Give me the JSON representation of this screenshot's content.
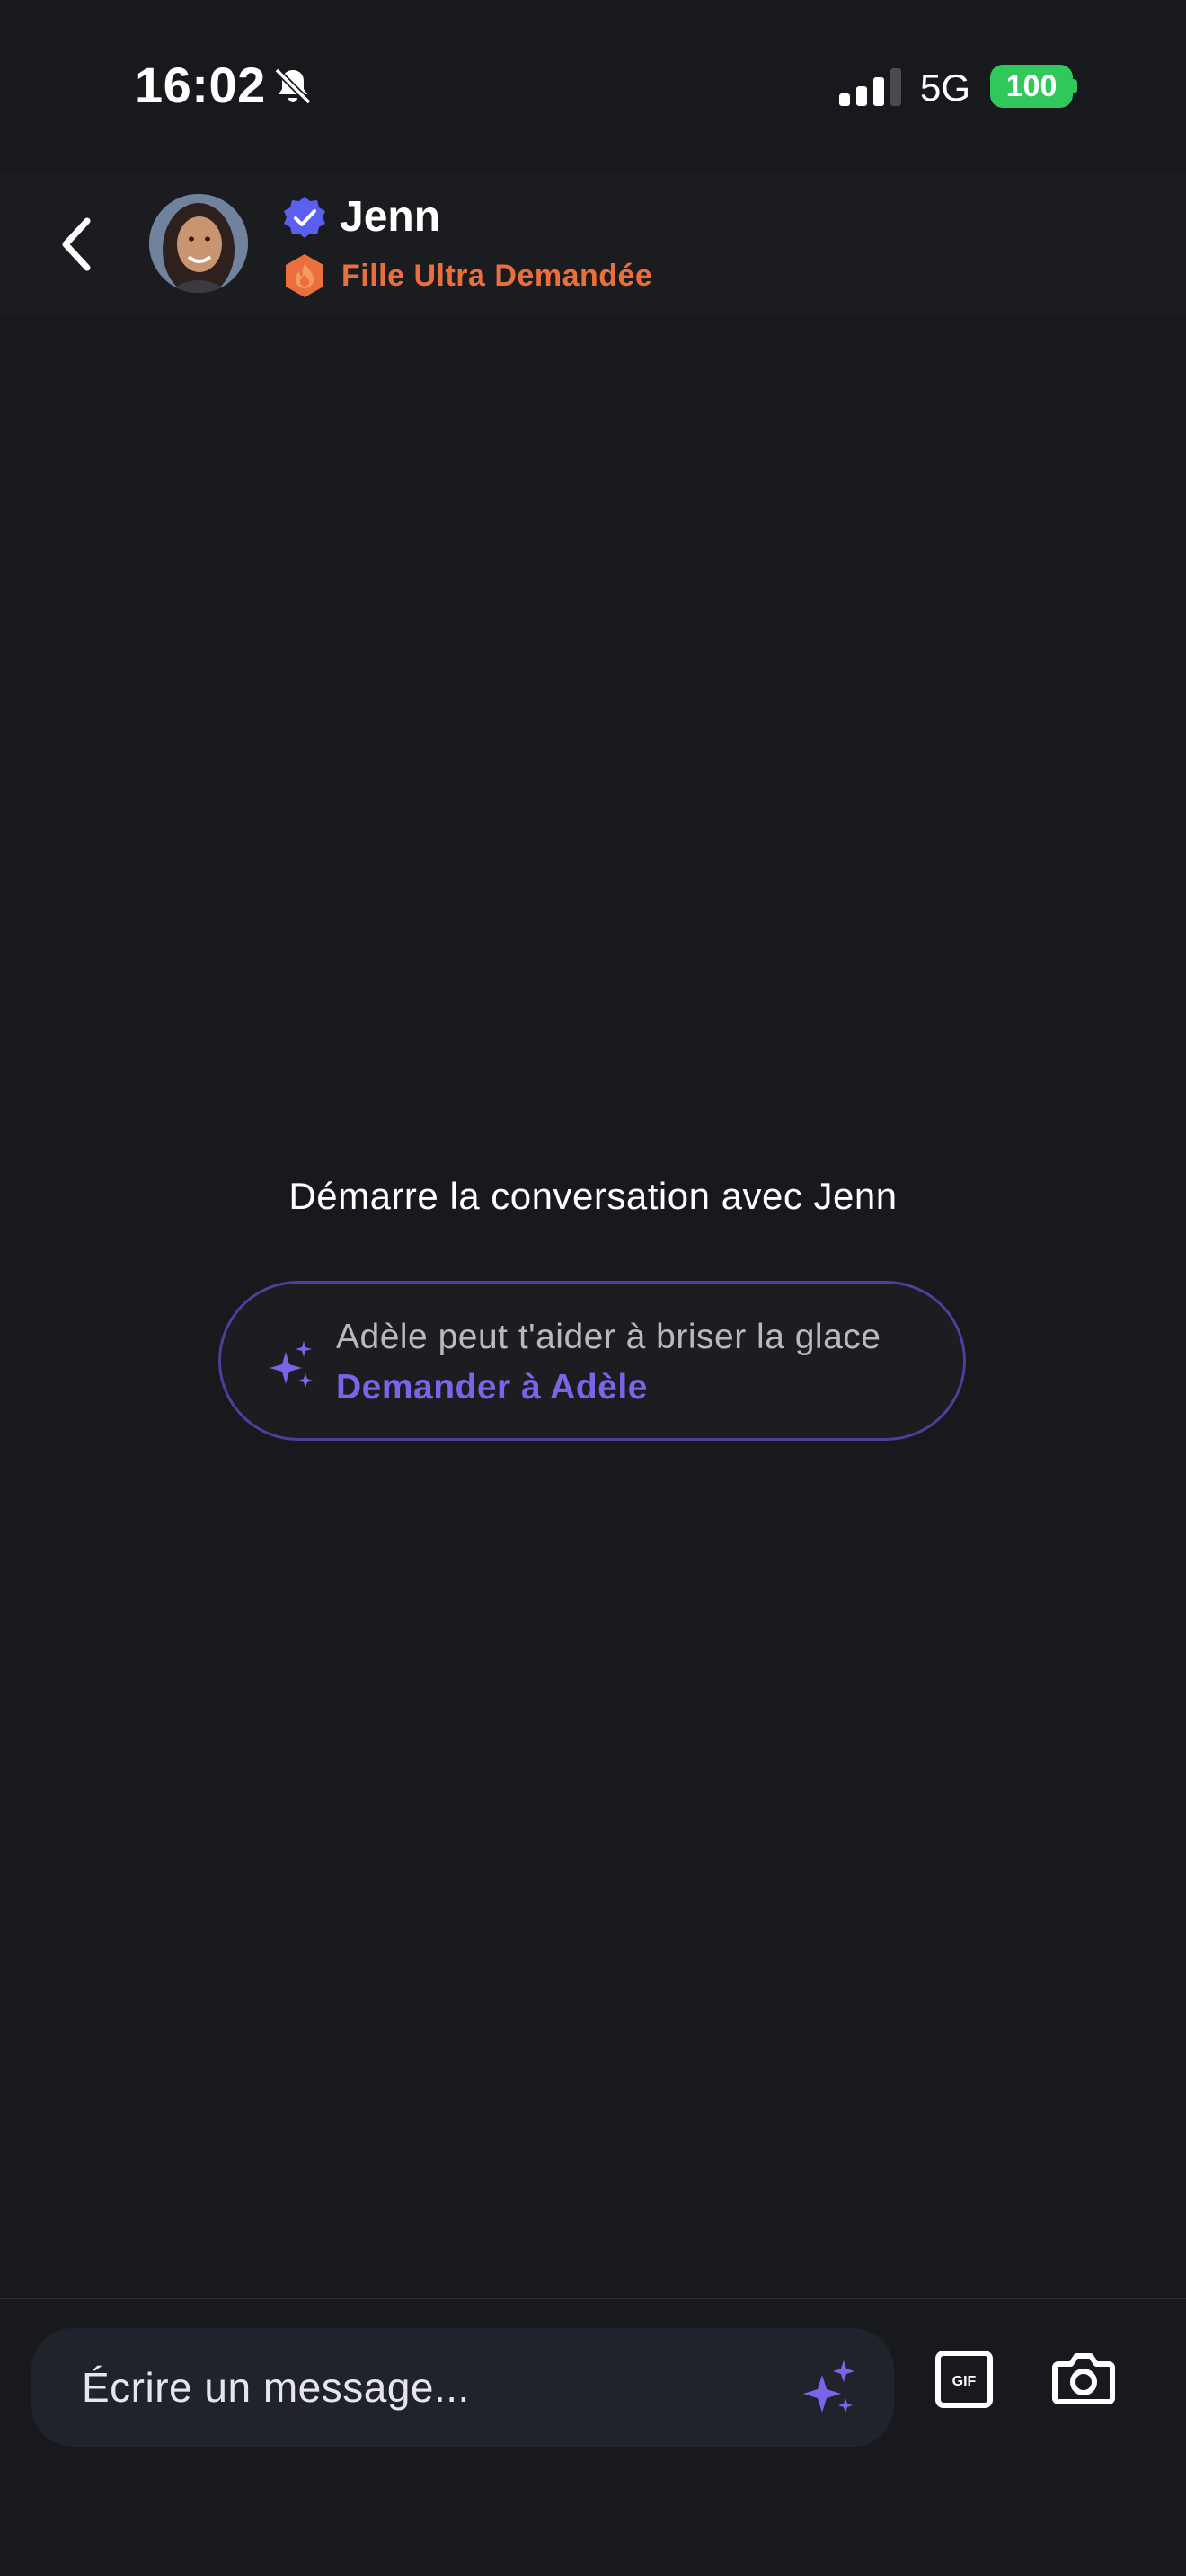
{
  "status_bar": {
    "time": "16:02",
    "network": "5G",
    "battery": "100"
  },
  "header": {
    "name": "Jenn",
    "subtitle": "Fille Ultra Demandée"
  },
  "empty_state": {
    "title": "Démarre la conversation avec Jenn",
    "icebreaker_text": "Adèle peut t'aider à briser la glace",
    "icebreaker_link": "Demander à Adèle"
  },
  "composer": {
    "placeholder": "Écrire un message...",
    "gif_label": "GIF"
  },
  "icons": {
    "back": "chevron-left-icon",
    "bell_off": "bell-slash-icon",
    "signal": "signal-bars-icon",
    "verified": "verified-badge-icon",
    "badge": "flame-hexagon-icon",
    "sparkles": "sparkles-icon",
    "gif": "gif-icon",
    "camera": "camera-icon"
  },
  "colors": {
    "background": "#18191d",
    "accent_purple": "#7b64e8",
    "subtitle_orange": "#ea6f3d",
    "battery_green": "#30c85a",
    "verified_blue": "#5b5ff0"
  }
}
